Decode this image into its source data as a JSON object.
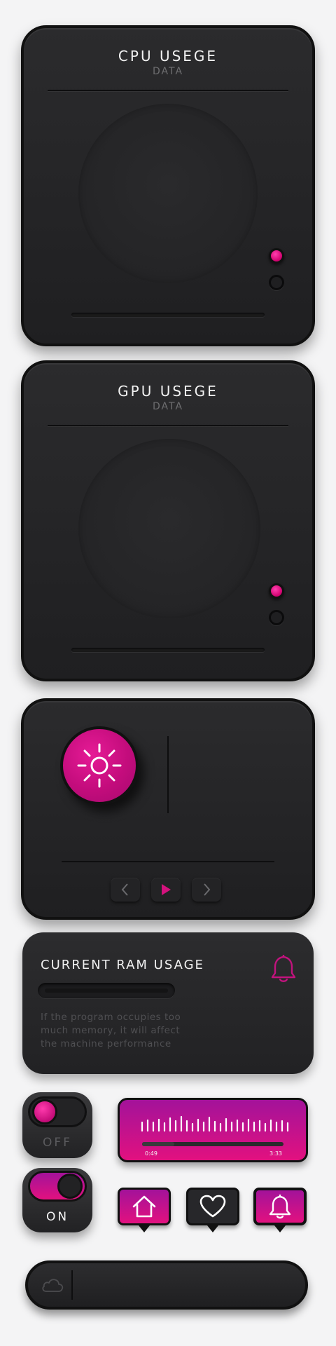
{
  "cpu_card": {
    "title": "CPU USEGE",
    "subtitle": "DATA"
  },
  "gpu_card": {
    "title": "GPU USEGE",
    "subtitle": "DATA"
  },
  "control_card": {
    "sun_icon": "sun-icon",
    "buttons": [
      {
        "name": "prev",
        "icon": "chevron-left-icon"
      },
      {
        "name": "play",
        "icon": "play-icon"
      },
      {
        "name": "next",
        "icon": "chevron-right-icon"
      }
    ]
  },
  "ram_card": {
    "title": "CURRENT RAM USAGE",
    "description_lines": [
      "If the program occupies too",
      "much memory, it will affect",
      "the machine performance"
    ],
    "icon": "bell-icon"
  },
  "toggles": {
    "off_label": "OFF",
    "on_label": "ON"
  },
  "audio_player": {
    "elapsed": "0:49",
    "total": "3:33"
  },
  "badges": [
    {
      "icon": "home-icon"
    },
    {
      "icon": "heart-icon"
    },
    {
      "icon": "bell-icon"
    }
  ],
  "search_bar": {
    "icon": "cloud-icon"
  },
  "colors": {
    "accent": "#e0127f",
    "accent_dark": "#9e138f",
    "card_bg": "#262628",
    "page_bg": "#f4f4f5"
  }
}
